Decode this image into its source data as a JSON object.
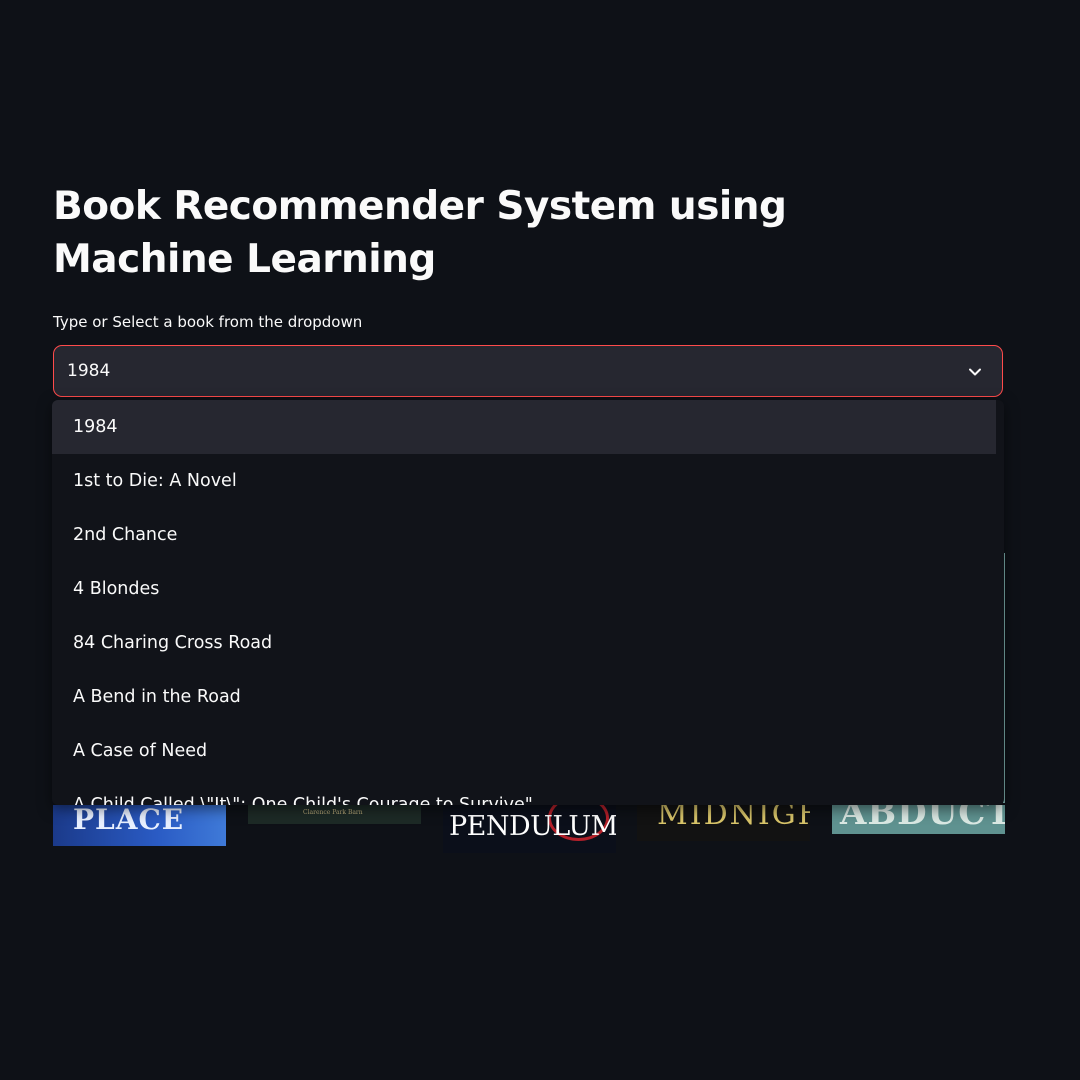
{
  "page": {
    "title": "Book Recommender System using Machine Learning"
  },
  "selector": {
    "label": "Type or Select a book from the dropdown",
    "value": "1984",
    "chevron_icon": "chevron-down-icon",
    "accent_color": "#ff4b4b"
  },
  "dropdown": {
    "options": [
      "1984",
      "1st to Die: A Novel",
      "2nd Chance",
      "4 Blondes",
      "84 Charing Cross Road",
      "A Bend in the Road",
      "A Case of Need"
    ],
    "partial_option": "A Child Called \\\"It\\\": One Child's Courage to Survive\""
  },
  "covers": {
    "items": [
      {
        "text": "PLACE"
      },
      {
        "text": "Clarence Park Barn"
      },
      {
        "text": "PENDULUM"
      },
      {
        "text": "MIDNIGHT"
      },
      {
        "text": "ABDUCTION"
      }
    ]
  }
}
